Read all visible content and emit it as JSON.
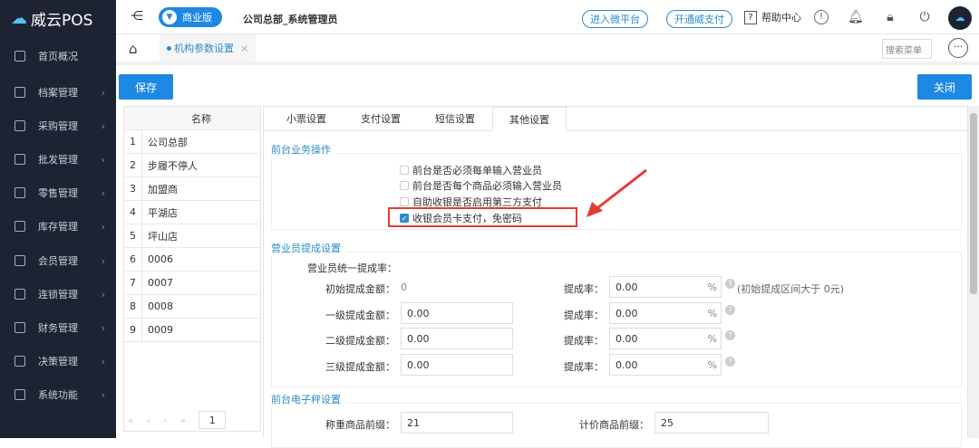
{
  "app": {
    "logo_text": "威云POS",
    "edition": "商业版",
    "user": "公司总部_系统管理员"
  },
  "header": {
    "micro_platform": "进入微平台",
    "open_pay": "开通威支付",
    "help": "帮助中心"
  },
  "sidebar": {
    "items": [
      {
        "label": "首页概况",
        "chev": false
      },
      {
        "label": "档案管理",
        "chev": true
      },
      {
        "label": "采购管理",
        "chev": true
      },
      {
        "label": "批发管理",
        "chev": true
      },
      {
        "label": "零售管理",
        "chev": true
      },
      {
        "label": "库存管理",
        "chev": true
      },
      {
        "label": "会员管理",
        "chev": true
      },
      {
        "label": "连锁管理",
        "chev": true
      },
      {
        "label": "财务管理",
        "chev": true
      },
      {
        "label": "决策管理",
        "chev": true
      },
      {
        "label": "系统功能",
        "chev": true
      }
    ]
  },
  "tabbar": {
    "active_tab": "机构参数设置",
    "search_placeholder": "搜索菜单"
  },
  "toolbar": {
    "save": "保存",
    "close": "关闭"
  },
  "left_list": {
    "header": "名称",
    "rows": [
      {
        "n": "1",
        "name": "公司总部"
      },
      {
        "n": "2",
        "name": "步履不停人"
      },
      {
        "n": "3",
        "name": "加盟商"
      },
      {
        "n": "4",
        "name": "平湖店"
      },
      {
        "n": "5",
        "name": "坪山店"
      },
      {
        "n": "6",
        "name": "0006"
      },
      {
        "n": "7",
        "name": "0007"
      },
      {
        "n": "8",
        "name": "0008"
      },
      {
        "n": "9",
        "name": "0009"
      }
    ],
    "page": "1"
  },
  "settings_tabs": [
    "小票设置",
    "支付设置",
    "短信设置",
    "其他设置"
  ],
  "front_ops": {
    "title": "前台业务操作",
    "options": [
      {
        "label": "前台是否必须每单输入营业员",
        "checked": false
      },
      {
        "label": "前台是否每个商品必须输入营业员",
        "checked": false
      },
      {
        "label": "自助收银是否启用第三方支付",
        "checked": false
      },
      {
        "label": "收银会员卡支付，免密码",
        "checked": true
      }
    ]
  },
  "commission": {
    "title": "营业员提成设置",
    "unified": "营业员统一提成率：",
    "rows": [
      {
        "label": "初始提成金额：",
        "amount": "0",
        "rate_label": "提成率：",
        "rate": "0.00",
        "note": "(初始提成区间大于 0元)"
      },
      {
        "label": "一级提成金额：",
        "amount": "0.00",
        "rate_label": "提成率：",
        "rate": "0.00",
        "note": ""
      },
      {
        "label": "二级提成金额：",
        "amount": "0.00",
        "rate_label": "提成率：",
        "rate": "0.00",
        "note": ""
      },
      {
        "label": "三级提成金额：",
        "amount": "0.00",
        "rate_label": "提成率：",
        "rate": "0.00",
        "note": ""
      }
    ],
    "percent": "%"
  },
  "scale": {
    "title": "前台电子秤设置",
    "weight_label": "称重商品前缀：",
    "weight_value": "21",
    "price_label": "计价商品前缀：",
    "price_value": "25"
  },
  "colors": {
    "accent": "#1e88e5",
    "sidebar": "#1d2333",
    "highlight": "#e53935"
  }
}
